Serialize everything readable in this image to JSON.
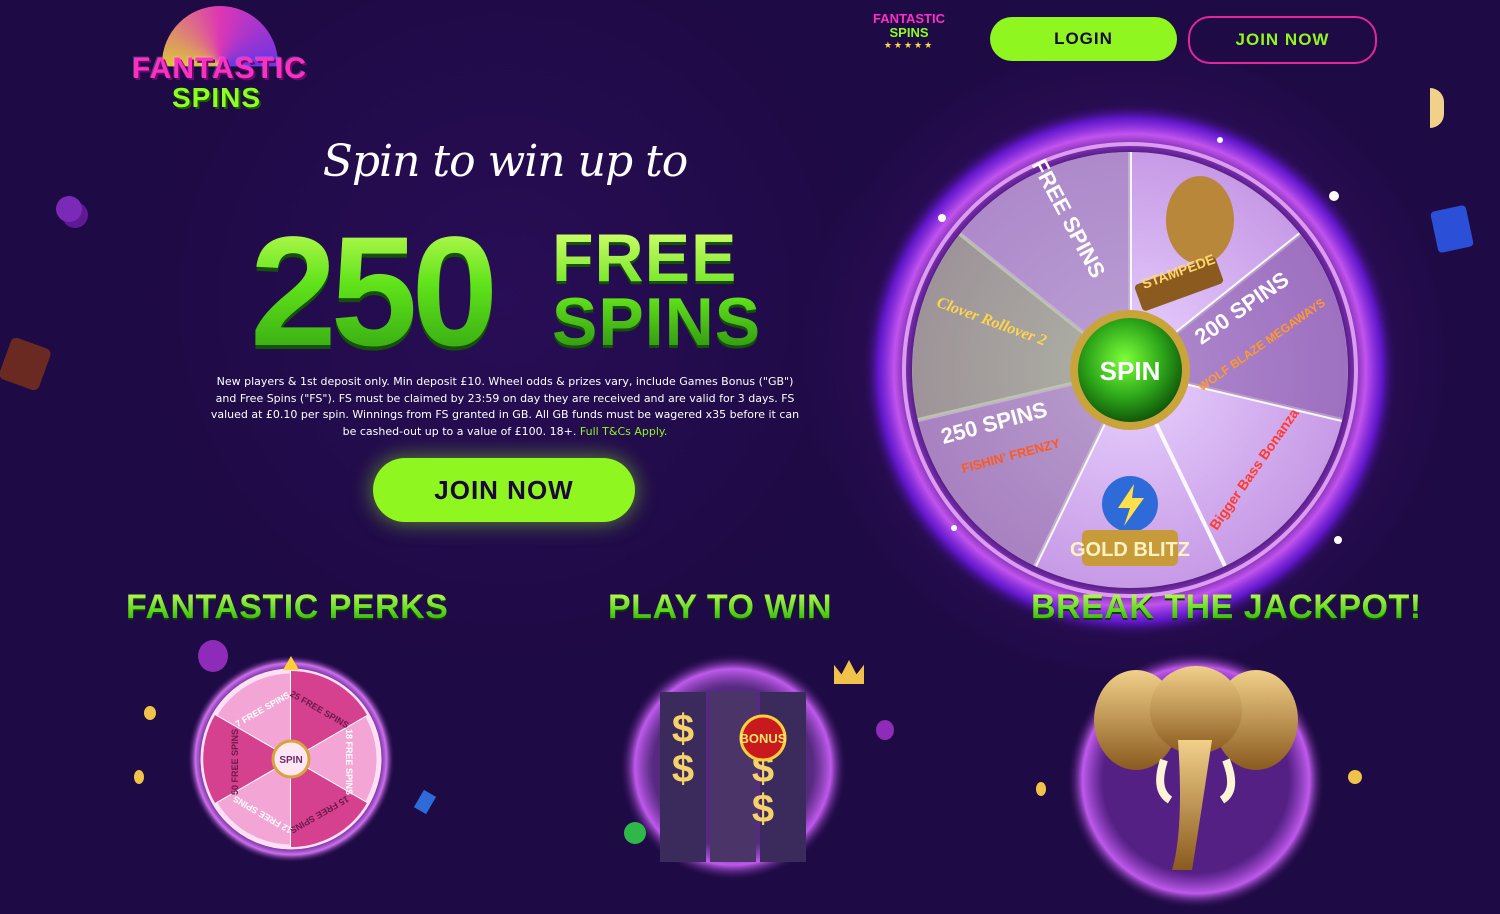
{
  "brand": {
    "logo_line1": "FANTASTIC",
    "logo_line2": "SPINS",
    "mini_line1": "FANTASTIC",
    "mini_line2": "SPINS",
    "mini_stars": "★★★★★"
  },
  "header": {
    "login_label": "LOGIN",
    "join_label": "JOIN NOW"
  },
  "hero": {
    "tagline": "Spin to win up to",
    "number": "250",
    "free_line": "FREE",
    "spins_line": "SPINS",
    "terms": "New players & 1st deposit only. Min deposit £10. Wheel odds & prizes vary, include Games Bonus (\"GB\") and Free Spins (\"FS\"). FS must be claimed by 23:59 on day they are received and are valid for 3 days. FS valued at £0.10 per spin. Winnings from FS granted in GB. All GB funds must be wagered x35 before it can be cashed-out up to a value of £100. 18+.",
    "terms_link": "Full T&Cs Apply.",
    "cta_label": "JOIN NOW"
  },
  "wheel": {
    "center_label": "SPIN",
    "segments": [
      "FREE SPINS",
      "STAMPEDE",
      "200 SPINS",
      "Bigger Bass Bonanza",
      "GOLD BLITZ",
      "250 SPINS",
      "Clover Rollover 2"
    ],
    "segment_extras": [
      "",
      "",
      "WOLF BLAZE MEGAWAYS",
      "",
      "",
      "FISHIN' FRENZY",
      ""
    ]
  },
  "sections": [
    {
      "title": "FANTASTIC PERKS"
    },
    {
      "title": "PLAY TO WIN"
    },
    {
      "title": "BREAK THE JACKPOT!"
    }
  ],
  "perks_wheel": {
    "center_label": "SPIN",
    "segments": [
      "7 FREE SPINS",
      "25 FREE SPINS",
      "18 FREE SPINS",
      "15 FREE SPINS",
      "12 FREE SPINS",
      "50 FREE SPINS"
    ]
  },
  "slots": {
    "bonus_label": "BONUS"
  },
  "colors": {
    "background": "#1e0a44",
    "accent_green": "#8ff61f",
    "accent_pink": "#e2269b",
    "glow_purple": "#b23cff"
  }
}
